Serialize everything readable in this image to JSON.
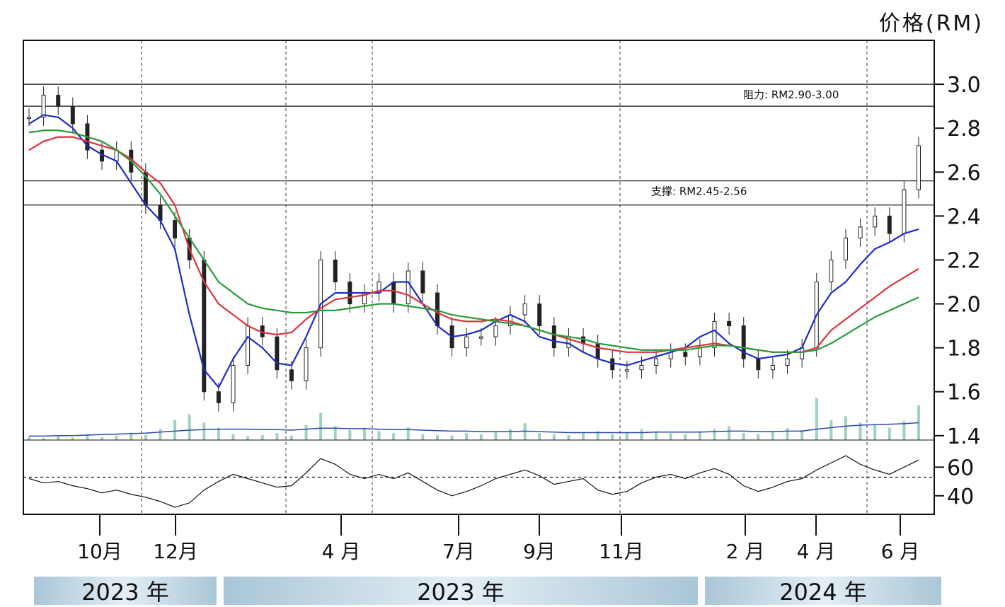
{
  "unit_title": "价格(RM)",
  "year_bands": [
    "2023 年",
    "2023 年",
    "2024 年"
  ],
  "colors": {
    "ma_short": "#1c2cc8",
    "ma_mid": "#e0323c",
    "ma_long": "#2a9a3a",
    "candle": "#222222",
    "volume": "#9fd0c0",
    "volume_ma": "#2a4ab0",
    "rsi": "#111111"
  },
  "chart_data": {
    "type": "line",
    "title": "",
    "ylabel": "价格(RM)",
    "ylim": [
      1.38,
      3.2
    ],
    "x_ticks": [
      "10月",
      "12月",
      "4 月",
      "7月",
      "9月",
      "11月",
      "2 月",
      "4 月",
      "6 月"
    ],
    "y_ticks": [
      "3.0",
      "2.8",
      "2.6",
      "2.4",
      "2.2",
      "2.0",
      "1.8",
      "1.6",
      "1.4"
    ],
    "levels": [
      {
        "label": "阻力: RM2.90-3.00",
        "low": 2.9,
        "high": 3.0
      },
      {
        "label": "支撑: RM2.45-2.56",
        "low": 2.45,
        "high": 2.56
      }
    ],
    "series": [
      {
        "name": "close",
        "values": [
          2.85,
          2.95,
          2.9,
          2.82,
          2.7,
          2.65,
          2.7,
          2.6,
          2.45,
          2.38,
          2.3,
          2.2,
          1.6,
          1.55,
          1.72,
          1.9,
          1.85,
          1.7,
          1.65,
          1.8,
          2.2,
          2.1,
          2.0,
          2.05,
          2.1,
          2.0,
          2.15,
          2.05,
          1.9,
          1.8,
          1.85,
          1.85,
          1.9,
          1.95,
          2.0,
          1.9,
          1.8,
          1.85,
          1.82,
          1.75,
          1.7,
          1.7,
          1.72,
          1.75,
          1.78,
          1.76,
          1.8,
          1.92,
          1.9,
          1.75,
          1.7,
          1.72,
          1.75,
          1.8,
          2.1,
          2.2,
          2.3,
          2.35,
          2.4,
          2.32,
          2.52,
          2.72
        ]
      },
      {
        "name": "",
        "values": [
          2.82,
          2.86,
          2.85,
          2.8,
          2.72,
          2.68,
          2.65,
          2.55,
          2.45,
          2.38,
          2.25,
          1.95,
          1.7,
          1.62,
          1.75,
          1.85,
          1.8,
          1.73,
          1.72,
          1.85,
          2.0,
          2.05,
          2.05,
          2.05,
          2.05,
          2.1,
          2.1,
          2.0,
          1.9,
          1.85,
          1.86,
          1.88,
          1.92,
          1.95,
          1.92,
          1.85,
          1.83,
          1.82,
          1.78,
          1.75,
          1.73,
          1.72,
          1.74,
          1.76,
          1.78,
          1.8,
          1.85,
          1.88,
          1.82,
          1.78,
          1.75,
          1.76,
          1.77,
          1.8,
          1.95,
          2.05,
          2.1,
          2.18,
          2.25,
          2.28,
          2.32,
          2.34
        ]
      },
      {
        "name": "",
        "values": [
          2.7,
          2.74,
          2.76,
          2.76,
          2.74,
          2.72,
          2.7,
          2.66,
          2.6,
          2.55,
          2.45,
          2.25,
          2.1,
          2.0,
          1.95,
          1.9,
          1.87,
          1.86,
          1.87,
          1.93,
          1.98,
          2.02,
          2.03,
          2.04,
          2.06,
          2.06,
          2.04,
          2.0,
          1.96,
          1.93,
          1.92,
          1.92,
          1.93,
          1.92,
          1.9,
          1.88,
          1.86,
          1.84,
          1.82,
          1.8,
          1.79,
          1.78,
          1.78,
          1.78,
          1.79,
          1.8,
          1.81,
          1.82,
          1.81,
          1.8,
          1.79,
          1.78,
          1.78,
          1.78,
          1.8,
          1.88,
          1.93,
          1.98,
          2.03,
          2.08,
          2.12,
          2.16
        ]
      },
      {
        "name": "",
        "values": [
          2.78,
          2.79,
          2.79,
          2.78,
          2.76,
          2.74,
          2.7,
          2.65,
          2.58,
          2.5,
          2.4,
          2.3,
          2.2,
          2.1,
          2.05,
          2.0,
          1.98,
          1.97,
          1.96,
          1.96,
          1.97,
          1.97,
          1.98,
          1.99,
          2.0,
          2.0,
          1.99,
          1.98,
          1.97,
          1.95,
          1.94,
          1.93,
          1.92,
          1.91,
          1.9,
          1.88,
          1.86,
          1.85,
          1.84,
          1.82,
          1.81,
          1.8,
          1.79,
          1.79,
          1.79,
          1.79,
          1.8,
          1.81,
          1.81,
          1.8,
          1.79,
          1.78,
          1.78,
          1.78,
          1.79,
          1.82,
          1.86,
          1.9,
          1.94,
          1.97,
          2.0,
          2.03
        ]
      }
    ],
    "rsi": {
      "ylim": [
        30,
        75
      ],
      "y_ticks": [
        "60",
        "40"
      ],
      "reference": 53,
      "values": [
        52,
        49,
        50,
        47,
        45,
        42,
        44,
        41,
        39,
        36,
        32,
        35,
        44,
        50,
        55,
        52,
        49,
        46,
        47,
        56,
        66,
        62,
        55,
        52,
        55,
        52,
        56,
        50,
        44,
        40,
        43,
        47,
        52,
        55,
        58,
        54,
        48,
        50,
        52,
        44,
        41,
        43,
        49,
        53,
        55,
        52,
        56,
        59,
        55,
        47,
        43,
        46,
        50,
        52,
        58,
        63,
        68,
        62,
        58,
        55,
        60,
        65
      ]
    },
    "volume": {
      "values": [
        6,
        4,
        8,
        5,
        12,
        6,
        9,
        15,
        10,
        22,
        40,
        52,
        35,
        25,
        12,
        8,
        10,
        14,
        9,
        30,
        55,
        28,
        20,
        25,
        18,
        14,
        26,
        12,
        10,
        9,
        14,
        12,
        16,
        22,
        34,
        14,
        12,
        10,
        15,
        18,
        12,
        16,
        22,
        18,
        14,
        12,
        18,
        22,
        28,
        14,
        12,
        18,
        24,
        20,
        85,
        40,
        48,
        35,
        30,
        25,
        38,
        70
      ],
      "ma_values": [
        8,
        8,
        9,
        9,
        10,
        11,
        12,
        13,
        14,
        16,
        18,
        20,
        21,
        22,
        22,
        22,
        21,
        21,
        20,
        22,
        24,
        24,
        23,
        23,
        22,
        21,
        21,
        20,
        19,
        18,
        18,
        17,
        17,
        17,
        18,
        17,
        16,
        15,
        15,
        15,
        15,
        15,
        15,
        16,
        16,
        16,
        16,
        17,
        18,
        18,
        17,
        17,
        18,
        18,
        22,
        25,
        28,
        30,
        31,
        32,
        33,
        35
      ]
    }
  }
}
